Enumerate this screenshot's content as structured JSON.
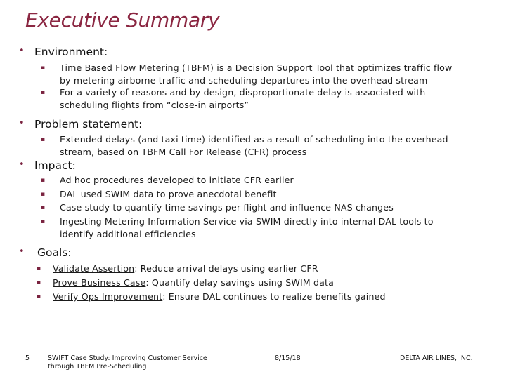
{
  "slide": {
    "title": "Executive Summary",
    "sections": [
      {
        "heading": "Environment:",
        "bullets": [
          {
            "lines": [
              "Time Based Flow Metering (TBFM) is a Decision Support Tool that optimizes traffic flow",
              "by metering airborne traffic and scheduling departures into the overhead stream"
            ]
          },
          {
            "lines": [
              "For a variety of reasons and by design, disproportionate delay is associated with",
              "scheduling flights from “close-in airports”"
            ]
          }
        ]
      },
      {
        "heading": "Problem statement:",
        "bullets": [
          {
            "lines": [
              "Extended delays (and taxi time) identified as a result of scheduling into the overhead",
              "stream, based on TBFM Call For Release (CFR) process"
            ]
          }
        ]
      },
      {
        "heading": "Impact:",
        "bullets": [
          {
            "lines": [
              "Ad hoc procedures developed to initiate CFR earlier"
            ]
          },
          {
            "lines": [
              "DAL used SWIM data to prove anecdotal benefit"
            ]
          },
          {
            "lines": [
              "Case study to quantify time savings per flight and influence NAS changes"
            ]
          },
          {
            "lines": [
              "Ingesting Metering Information Service via SWIM directly into internal DAL tools to",
              "identify additional efficiencies"
            ]
          }
        ]
      },
      {
        "heading": "Goals:",
        "bullets": [
          {
            "label": "Validate Assertion",
            "text": ": Reduce arrival delays using earlier CFR"
          },
          {
            "label": "Prove Business Case",
            "text": ": Quantify delay savings using SWIM data"
          },
          {
            "label": "Verify Ops Improvement",
            "text": ": Ensure DAL continues to realize benefits gained"
          }
        ]
      }
    ],
    "bullet_symbol": "•",
    "sub_bullet_symbol": "▪",
    "accent_color": "#8b2742"
  },
  "footer": {
    "page_number": "5",
    "presentation_title_line1": "SWIFT Case Study: Improving Customer Service",
    "presentation_title_line2": "through TBFM Pre-Scheduling",
    "date": "8/15/18",
    "company": "DELTA AIR LINES, INC."
  }
}
